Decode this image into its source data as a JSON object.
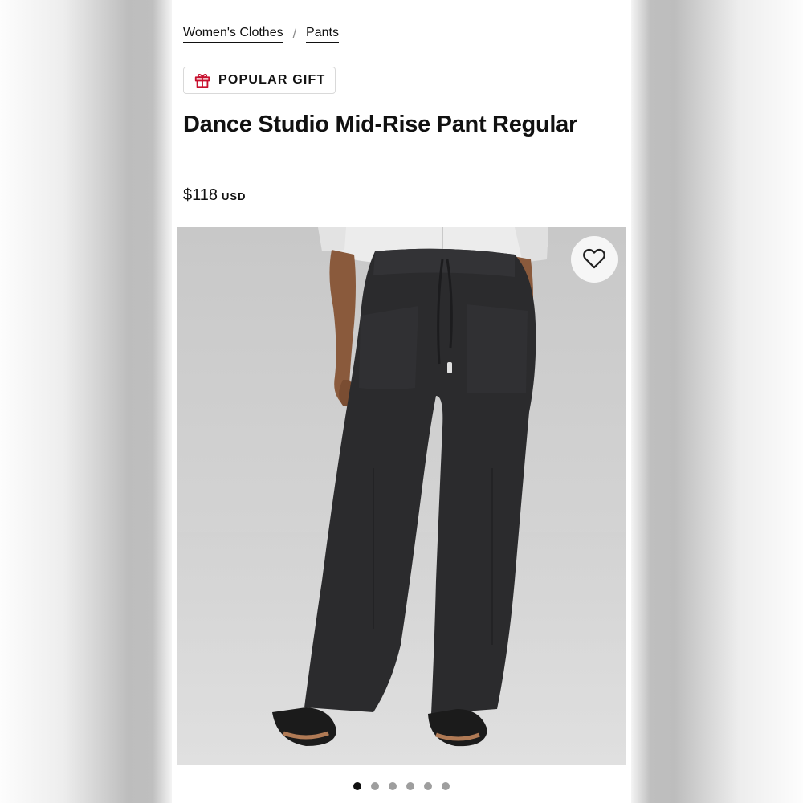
{
  "breadcrumb": {
    "items": [
      {
        "label": "Women's Clothes"
      },
      {
        "label": "Pants"
      }
    ],
    "separator": "/"
  },
  "badge": {
    "icon": "gift-icon",
    "label": "POPULAR GIFT",
    "icon_color": "#c8102e"
  },
  "product": {
    "title": "Dance Studio Mid-Rise Pant Regular",
    "price": "$118",
    "currency": "USD"
  },
  "gallery": {
    "wishlist_icon": "heart-outline-icon",
    "image_count": 6,
    "active_index": 0
  }
}
